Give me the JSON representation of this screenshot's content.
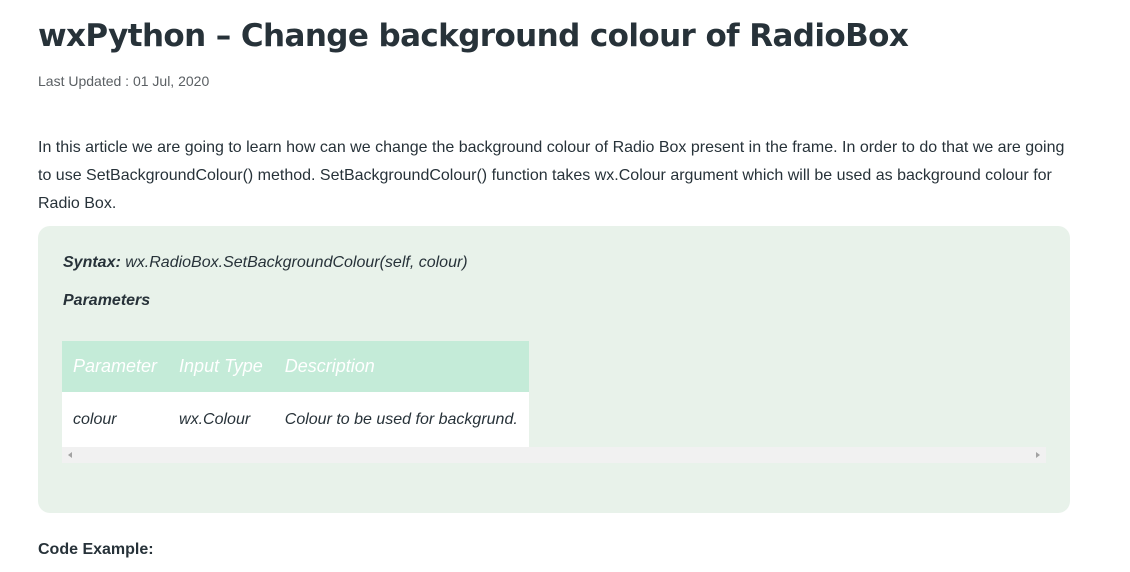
{
  "article": {
    "title": "wxPython – Change background colour of RadioBox",
    "last_updated": "Last Updated : 01 Jul, 2020",
    "intro": "In this article we are going to learn how can we change the background colour of Radio Box present in the frame. In order to do that we are going to use SetBackgroundColour() method. SetBackgroundColour() function takes wx.Colour argument which will be used as background colour for Radio Box."
  },
  "syntax_box": {
    "syntax_label": "Syntax:",
    "syntax_signature": " wx.RadioBox.SetBackgroundColour(self, colour)",
    "parameters_heading": "Parameters",
    "table": {
      "headers": [
        "Parameter",
        "Input Type",
        "Description"
      ],
      "rows": [
        [
          "colour",
          "wx.Colour",
          "Colour to be used for backgrund."
        ]
      ]
    }
  },
  "code_example_heading": "Code Example:",
  "colors": {
    "syntax_box_bg": "#e8f2ea",
    "table_header_bg": "#c4ebd8",
    "text": "#273239"
  },
  "icons": {
    "scroll_left": "left-arrow-icon",
    "scroll_right": "right-arrow-icon"
  }
}
